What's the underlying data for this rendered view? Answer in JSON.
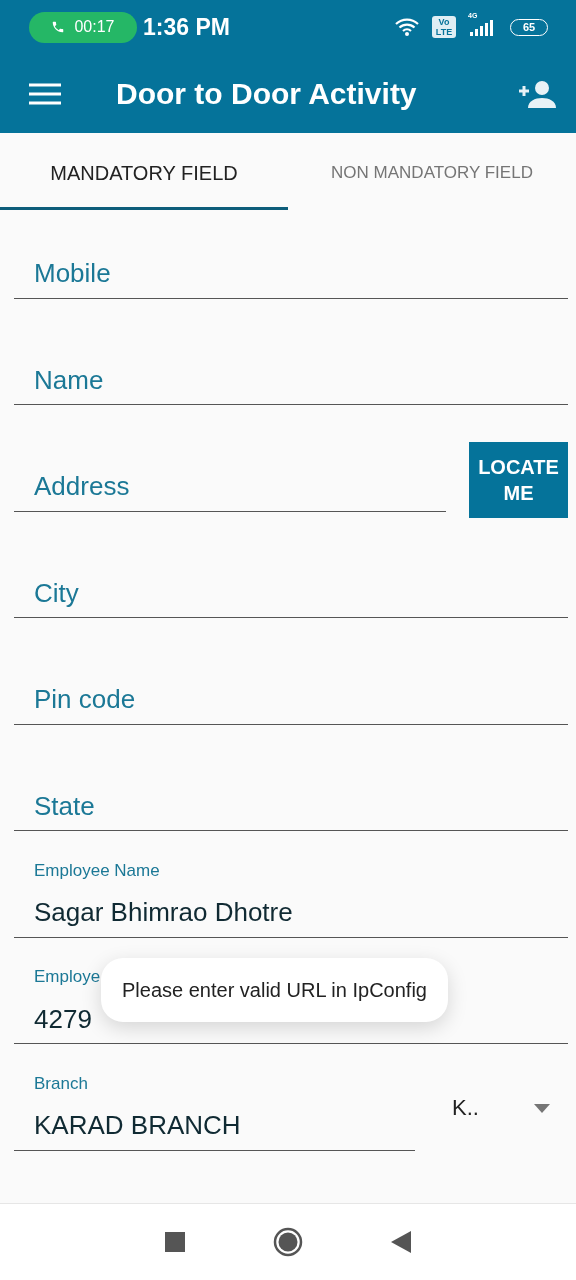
{
  "status_bar": {
    "call_timer": "00:17",
    "time": "1:36 PM",
    "volte_top": "Vo",
    "volte_bottom": "LTE",
    "network": "4G",
    "battery": "65"
  },
  "app_bar": {
    "title": "Door to Door Activity"
  },
  "tabs": [
    {
      "label": "MANDATORY FIELD",
      "selected": true
    },
    {
      "label": "NON MANDATORY FIELD",
      "selected": false
    }
  ],
  "fields": [
    {
      "kind": "empty",
      "placeholder": "Mobile"
    },
    {
      "kind": "empty",
      "placeholder": "Name"
    },
    {
      "kind": "empty",
      "placeholder": "Address",
      "action": "LOCATE ME"
    },
    {
      "kind": "empty",
      "placeholder": "City"
    },
    {
      "kind": "empty",
      "placeholder": "Pin code"
    },
    {
      "kind": "empty",
      "placeholder": "State"
    },
    {
      "kind": "filled",
      "label": "Employee Name",
      "value": "Sagar Bhimrao Dhotre"
    },
    {
      "kind": "filled",
      "label": "Employe",
      "value": "4279"
    },
    {
      "kind": "filled",
      "label": "Branch",
      "value": "KARAD BRANCH",
      "spinner": "K.."
    }
  ],
  "toast": {
    "message": "Please enter valid URL in IpConfig"
  }
}
